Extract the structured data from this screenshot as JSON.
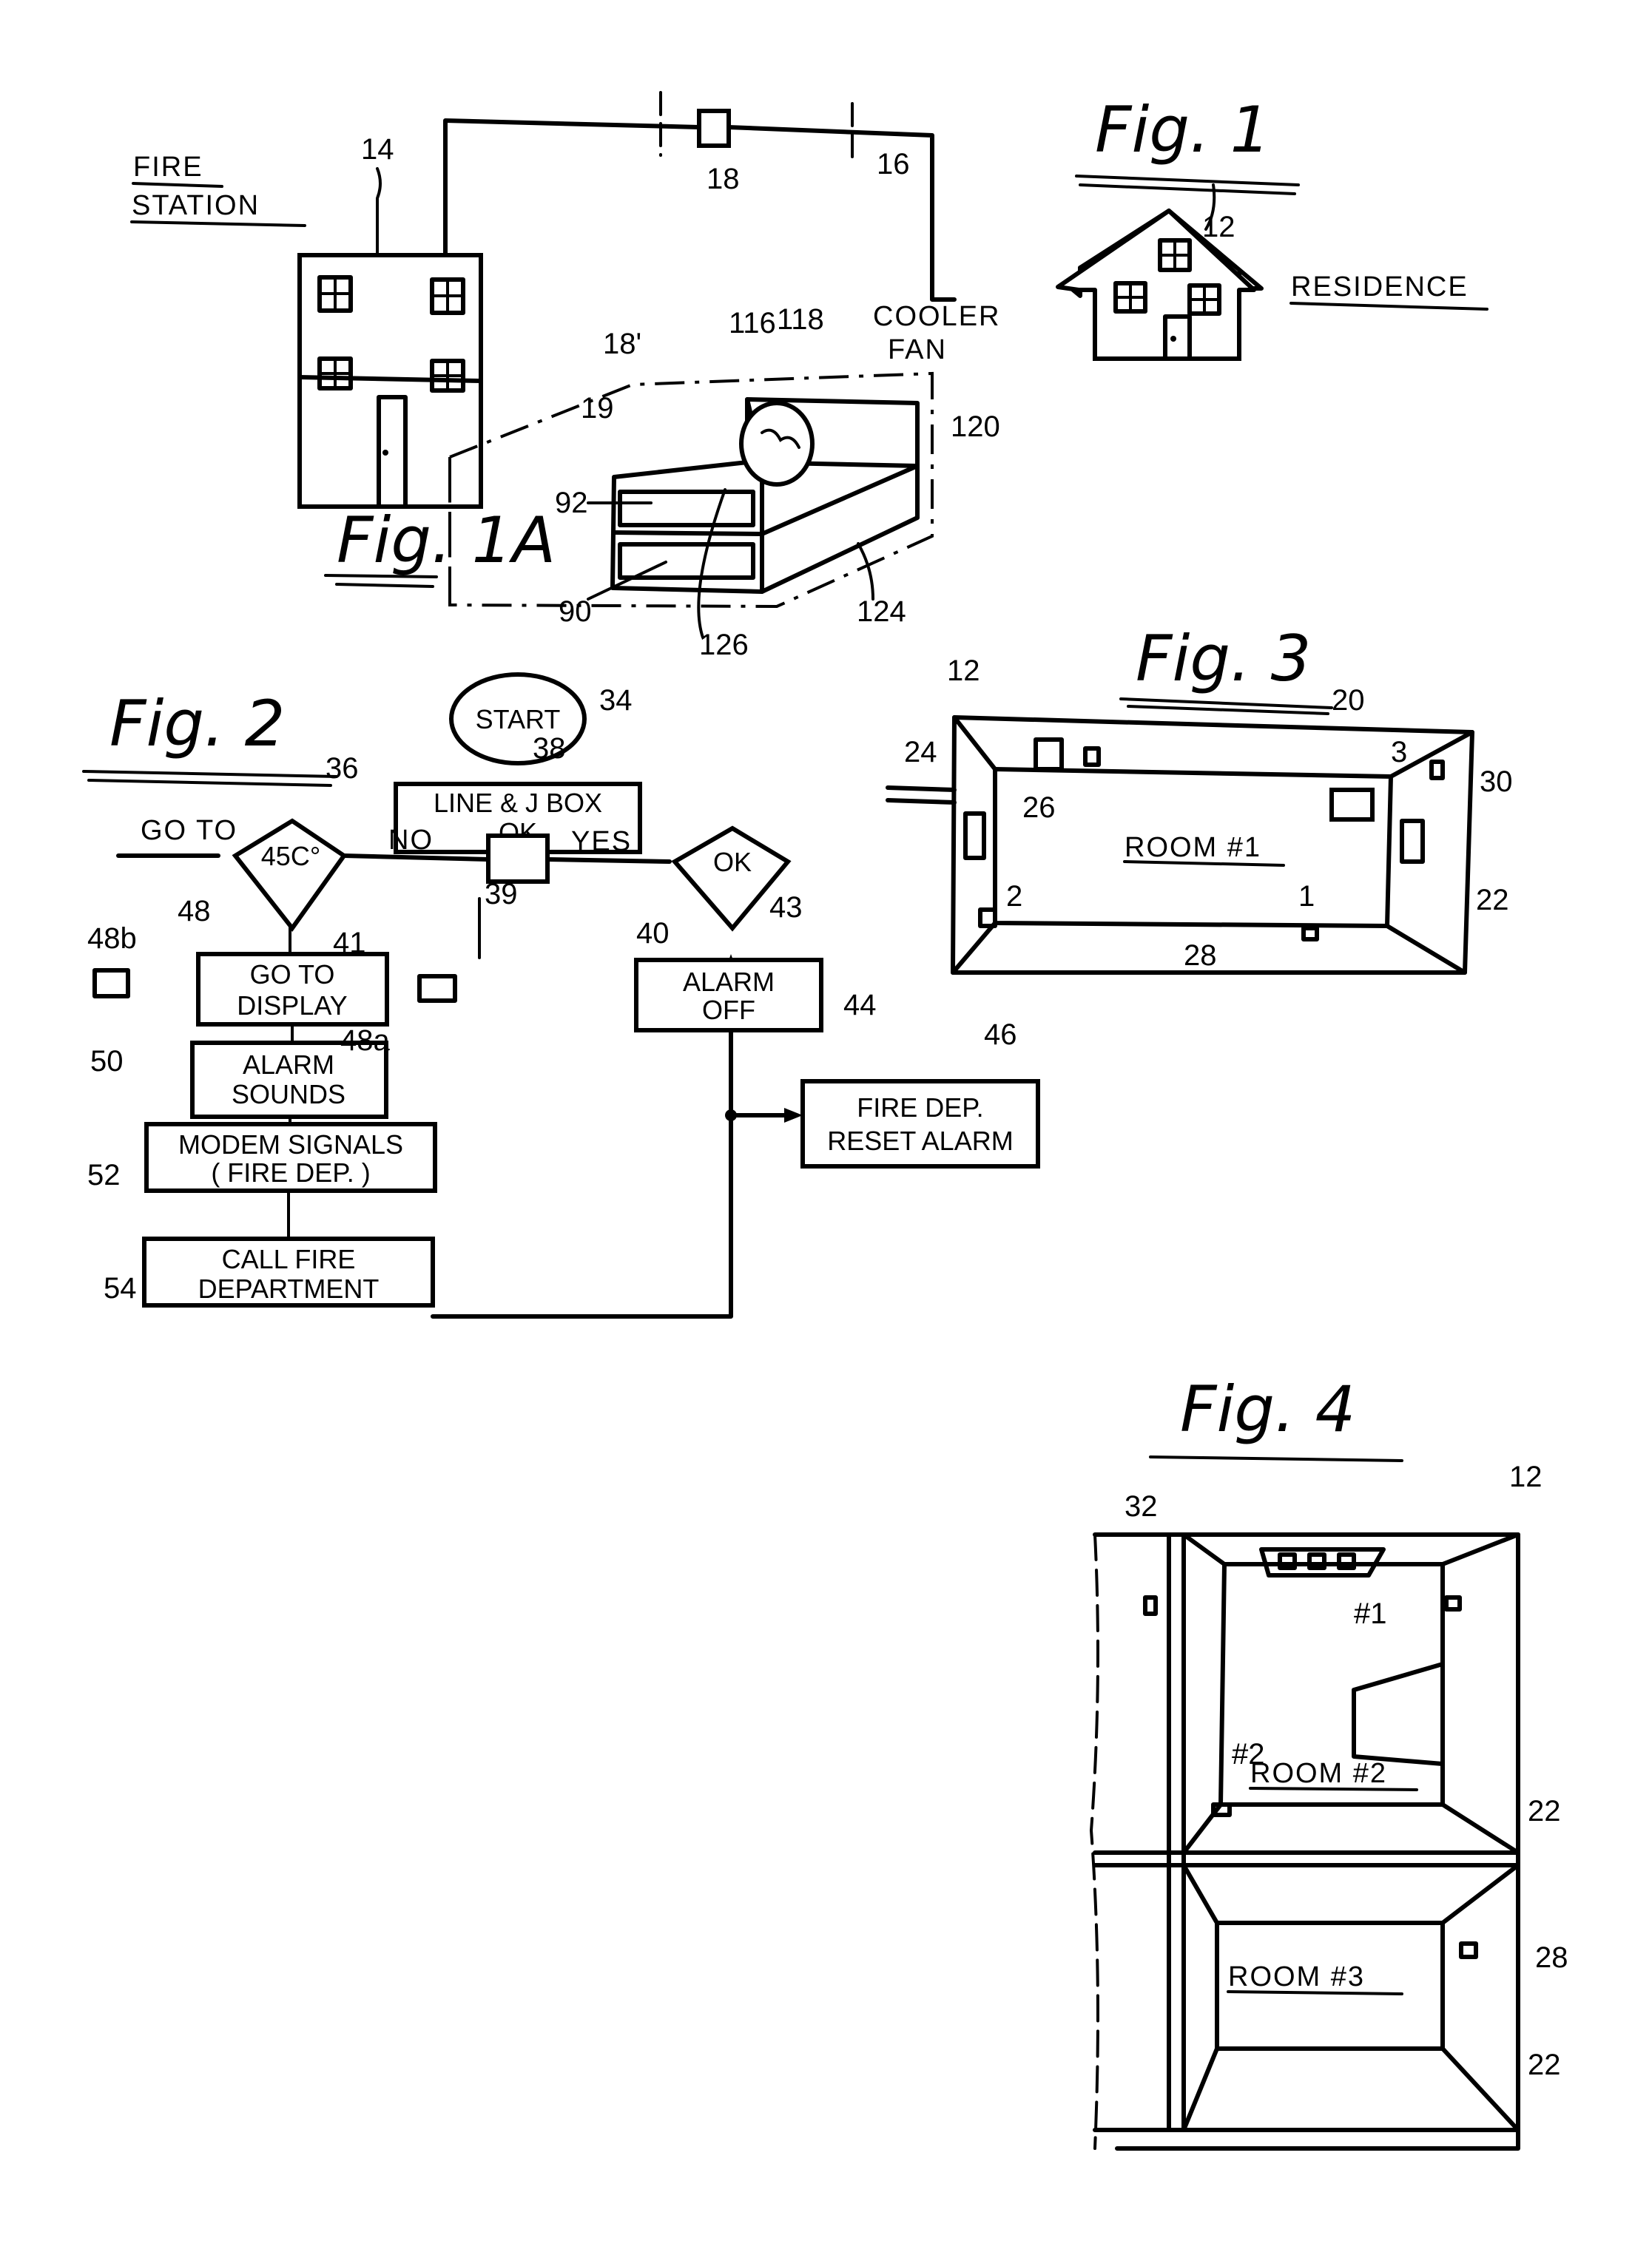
{
  "sheet": {
    "fig1": {
      "title": "Fig. 1",
      "fire_station_label_1": "FIRE",
      "fire_station_label_2": "STATION",
      "residence_label": "RESIDENCE",
      "refs": {
        "fire_station": "14",
        "line": "16",
        "junction": "18",
        "residence": "12"
      }
    },
    "fig1a": {
      "title": "Fig. 1A",
      "cooler_fan_1": "COOLER",
      "cooler_fan_2": "FAN",
      "refs": {
        "r18p": "18'",
        "r19": "19",
        "r116": "116",
        "r118": "118",
        "r120": "120",
        "r92": "92",
        "r90": "90",
        "r124": "124",
        "r126": "126"
      }
    },
    "fig2": {
      "title": "Fig. 2",
      "start": "START",
      "line_jbox_1": "LINE & J BOX",
      "line_jbox_2": "OK",
      "decision_temp": "45C°",
      "decision_ok": "OK",
      "go_to": "GO TO",
      "no": "NO",
      "yes": "YES",
      "go_to_display_1": "GO TO",
      "go_to_display_2": "DISPLAY",
      "alarm_off_1": "ALARM",
      "alarm_off_2": "OFF",
      "alarm_sounds_1": "ALARM",
      "alarm_sounds_2": "SOUNDS",
      "modem_1": "MODEM SIGNALS",
      "modem_2": "( FIRE DEP. )",
      "call_1": "CALL  FIRE",
      "call_2": "DEPARTMENT",
      "reset_1": "FIRE DEP.",
      "reset_2": "RESET ALARM",
      "refs": {
        "r34": "34",
        "r38": "38",
        "r36": "36",
        "r39": "39",
        "r43": "43",
        "r40": "40",
        "r41": "41",
        "r48": "48",
        "r48b": "48b",
        "r48a": "48a",
        "r44": "44",
        "r50": "50",
        "r52": "52",
        "r54": "54",
        "r46": "46"
      }
    },
    "fig3": {
      "title": "Fig. 3",
      "room": "ROOM #1",
      "refs": {
        "r12": "12",
        "r20": "20",
        "r24": "24",
        "r26": "26",
        "r30": "30",
        "r22": "22",
        "r28": "28",
        "s1": "1",
        "s2": "2",
        "s3": "3"
      }
    },
    "fig4": {
      "title": "Fig. 4",
      "room2": "ROOM #2",
      "room3": "ROOM #3",
      "refs": {
        "r12": "12",
        "r32": "32",
        "h1": "#1",
        "h2": "#2",
        "r22a": "22",
        "r22b": "22",
        "r28": "28"
      }
    }
  }
}
